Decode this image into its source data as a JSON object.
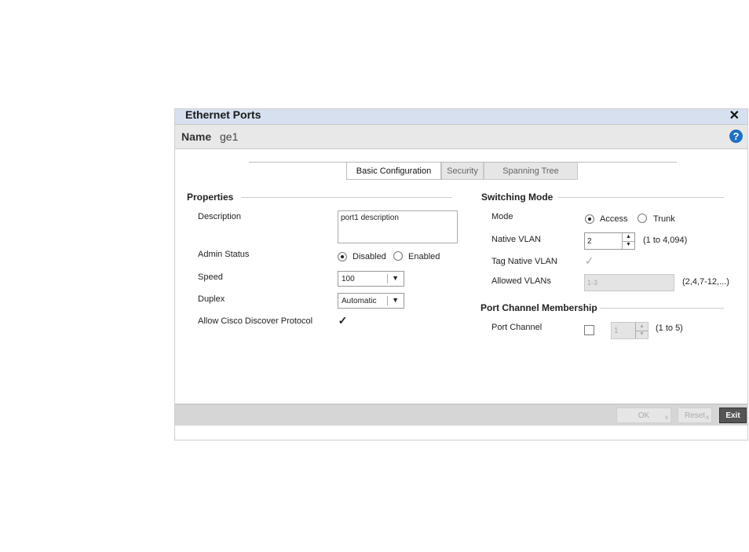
{
  "window": {
    "title": "Ethernet Ports",
    "name_label": "Name",
    "name_value": "ge1",
    "help": "?",
    "close": "✕"
  },
  "tabs": [
    {
      "label": "Basic Configuration",
      "active": true
    },
    {
      "label": "Security",
      "active": false
    },
    {
      "label": "Spanning Tree",
      "active": false
    }
  ],
  "properties": {
    "heading": "Properties",
    "description_label": "Description",
    "description_value": "port1 description",
    "admin_status_label": "Admin Status",
    "admin_status_options": [
      "Disabled",
      "Enabled"
    ],
    "admin_status_selected": "Disabled",
    "speed_label": "Speed",
    "speed_value": "100",
    "duplex_label": "Duplex",
    "duplex_value": "Automatic",
    "cdp_label": "Allow Cisco Discover Protocol",
    "cdp_checked": true
  },
  "switching": {
    "heading": "Switching Mode",
    "mode_label": "Mode",
    "mode_options": [
      "Access",
      "Trunk"
    ],
    "mode_selected": "Access",
    "native_vlan_label": "Native VLAN",
    "native_vlan_value": "2",
    "native_vlan_hint": "(1 to 4,094)",
    "tag_native_label": "Tag Native VLAN",
    "allowed_vlans_label": "Allowed VLANs",
    "allowed_vlans_value": "1-3",
    "allowed_vlans_hint": "(2,4,7-12,...)"
  },
  "port_channel": {
    "heading": "Port Channel Membership",
    "label": "Port Channel",
    "value": "1",
    "hint": "(1 to 5)"
  },
  "footer": {
    "ok": "OK",
    "reset": "Reset",
    "exit": "Exit",
    "sub": "x"
  },
  "glyphs": {
    "check": "✓",
    "caret": "▼",
    "up": "▲",
    "down": "▼"
  }
}
